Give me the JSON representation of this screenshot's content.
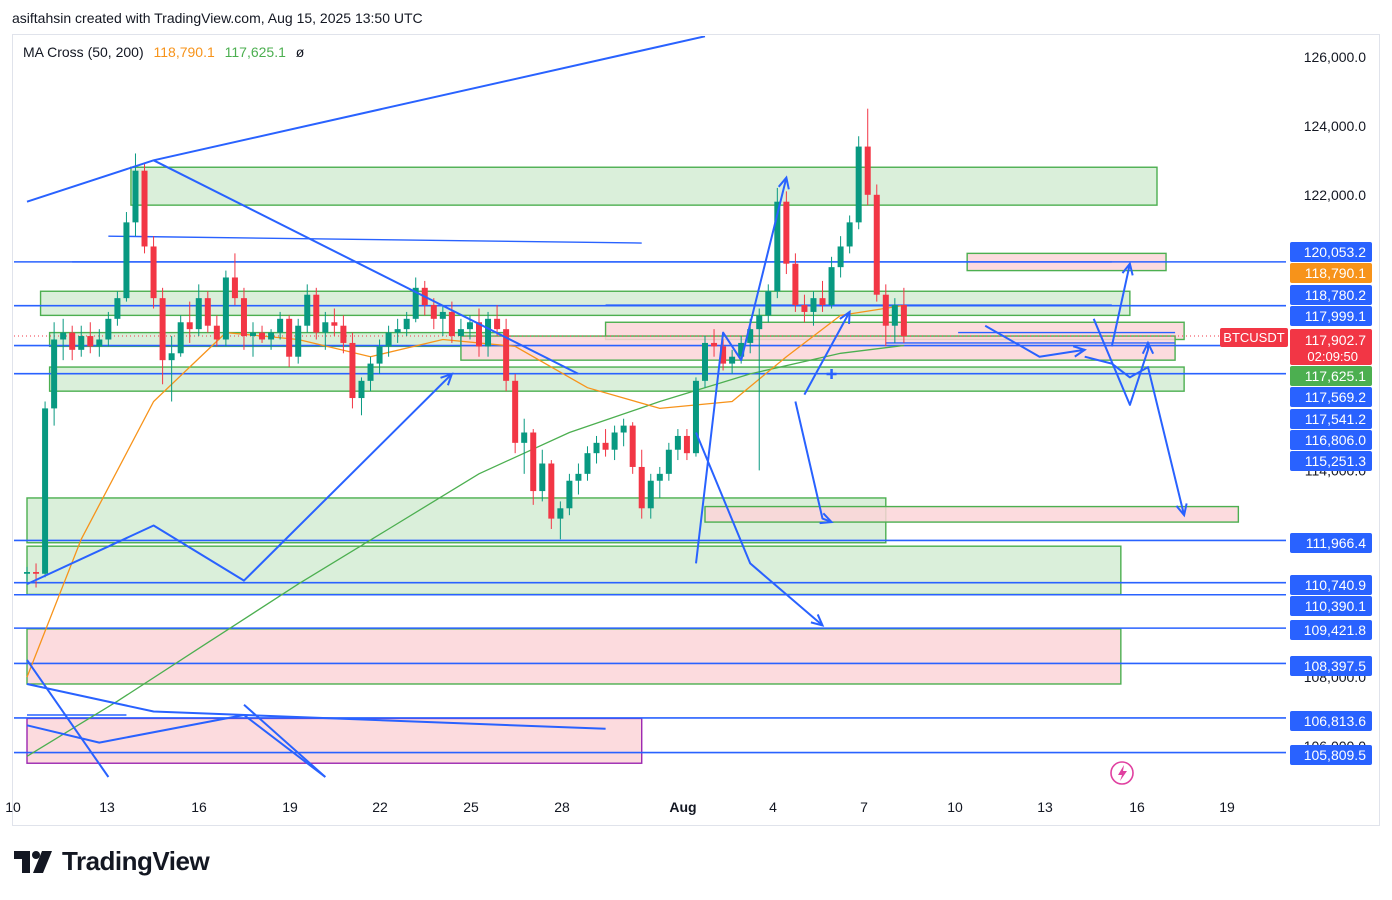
{
  "header": {
    "caption": "asiftahsin created with TradingView.com, Aug 15, 2025 13:50 UTC"
  },
  "legend": {
    "indicator": "MA Cross (50, 200)",
    "ma50_value": "118,790.1",
    "ma200_value": "117,625.1",
    "extra": "ø"
  },
  "symbol": {
    "ticker": "BTCUSDT",
    "price": "117,902.7",
    "countdown": "02:09:50"
  },
  "brand": {
    "name": "TradingView"
  },
  "colors": {
    "up": "#089981",
    "down": "#f23645",
    "ma50": "#f7931a",
    "ma200": "#4caf50",
    "drawing": "#2962ff",
    "zone_green_fill": "#d3ecd3",
    "zone_green_stroke": "#4caf50",
    "zone_pink_fill": "#fbd5d8",
    "zone_purple_stroke": "#9c27b0",
    "label_blue": "#2962ff",
    "label_orange": "#f7931a",
    "label_green": "#4caf50",
    "label_red": "#f23645"
  },
  "chart_data": {
    "type": "candlestick",
    "symbol": "BTCUSDT",
    "timeframe_note": "Jul 10 – Aug 15, 2025",
    "x_tick_labels": [
      "10",
      "13",
      "16",
      "19",
      "22",
      "25",
      "28",
      "Aug",
      "4",
      "7",
      "10",
      "13",
      "16",
      "19"
    ],
    "y_axis_ticks": [
      "126,000.0",
      "124,000.0",
      "122,000.0",
      "114,000.0",
      "108,000.0",
      "106,000.0"
    ],
    "ylim": [
      104800,
      127000
    ],
    "grid": false,
    "price_labels": [
      {
        "text": "120,053.2",
        "value": 120053.2,
        "style": "blue"
      },
      {
        "text": "118,790.1",
        "value": 118790.1,
        "style": "orange"
      },
      {
        "text": "118,780.2",
        "value": 118780.2,
        "style": "blue"
      },
      {
        "text": "117,999.1",
        "value": 117999.1,
        "style": "blue"
      },
      {
        "text": "117,625.1",
        "value": 117625.1,
        "style": "green"
      },
      {
        "text": "117,569.2",
        "value": 117569.2,
        "style": "blue"
      },
      {
        "text": "117,541.2",
        "value": 117541.2,
        "style": "blue"
      },
      {
        "text": "116,806.0",
        "value": 116806.0,
        "style": "blue"
      },
      {
        "text": "115,251.3",
        "value": 115251.3,
        "style": "blue"
      },
      {
        "text": "111,966.4",
        "value": 111966.4,
        "style": "blue"
      },
      {
        "text": "110,740.9",
        "value": 110740.9,
        "style": "blue"
      },
      {
        "text": "110,390.1",
        "value": 110390.1,
        "style": "blue"
      },
      {
        "text": "109,421.8",
        "value": 109421.8,
        "style": "blue"
      },
      {
        "text": "108,397.5",
        "value": 108397.5,
        "style": "blue"
      },
      {
        "text": "106,813.6",
        "value": 106813.6,
        "style": "blue"
      },
      {
        "text": "105,809.5",
        "value": 105809.5,
        "style": "blue"
      }
    ],
    "candles": [
      [
        111000,
        111200,
        110800,
        111050
      ],
      [
        111050,
        111300,
        110600,
        111000
      ],
      [
        111000,
        116000,
        110900,
        115800
      ],
      [
        115800,
        118300,
        115300,
        117800
      ],
      [
        117800,
        118400,
        117200,
        118000
      ],
      [
        118000,
        118200,
        117200,
        117500
      ],
      [
        117500,
        118200,
        117300,
        117900
      ],
      [
        117900,
        118300,
        117400,
        117600
      ],
      [
        117600,
        118100,
        117300,
        117800
      ],
      [
        117800,
        118600,
        117600,
        118400
      ],
      [
        118400,
        119200,
        118200,
        119000
      ],
      [
        119000,
        121500,
        118900,
        121200
      ],
      [
        121200,
        123200,
        120800,
        122700
      ],
      [
        122700,
        122900,
        120300,
        120500
      ],
      [
        120500,
        120800,
        118700,
        119000
      ],
      [
        119000,
        119300,
        116500,
        117200
      ],
      [
        117200,
        117900,
        116000,
        117400
      ],
      [
        117400,
        118500,
        117300,
        118300
      ],
      [
        118300,
        118900,
        117700,
        118100
      ],
      [
        118100,
        119400,
        117900,
        119000
      ],
      [
        119000,
        119200,
        118000,
        118200
      ],
      [
        118200,
        118500,
        117600,
        117800
      ],
      [
        117800,
        119800,
        117600,
        119600
      ],
      [
        119600,
        120300,
        118800,
        119000
      ],
      [
        119000,
        119300,
        117500,
        117900
      ],
      [
        117900,
        118300,
        117300,
        118000
      ],
      [
        118000,
        118200,
        117700,
        117800
      ],
      [
        117800,
        118100,
        117500,
        118000
      ],
      [
        118000,
        118600,
        117800,
        118400
      ],
      [
        118400,
        118500,
        117000,
        117300
      ],
      [
        117300,
        118400,
        117100,
        118200
      ],
      [
        118200,
        119400,
        118000,
        119100
      ],
      [
        119100,
        119300,
        117800,
        118000
      ],
      [
        118000,
        118600,
        117500,
        118300
      ],
      [
        118300,
        118700,
        117900,
        118200
      ],
      [
        118200,
        118500,
        117400,
        117700
      ],
      [
        117700,
        118000,
        115800,
        116100
      ],
      [
        116100,
        116700,
        115600,
        116600
      ],
      [
        116600,
        117300,
        116300,
        117100
      ],
      [
        117100,
        117800,
        116800,
        117600
      ],
      [
        117600,
        118200,
        117300,
        118000
      ],
      [
        118000,
        118400,
        117700,
        118100
      ],
      [
        118100,
        118600,
        117900,
        118400
      ],
      [
        118400,
        119600,
        118300,
        119300
      ],
      [
        119300,
        119500,
        118500,
        118800
      ],
      [
        118800,
        119000,
        118100,
        118400
      ],
      [
        118400,
        118800,
        117900,
        118600
      ],
      [
        118600,
        118900,
        117700,
        117900
      ],
      [
        117900,
        118400,
        117600,
        118100
      ],
      [
        118100,
        118500,
        117800,
        118300
      ],
      [
        118300,
        118700,
        117300,
        117600
      ],
      [
        117600,
        118600,
        117300,
        118400
      ],
      [
        118400,
        118800,
        117900,
        118100
      ],
      [
        118100,
        118400,
        116300,
        116600
      ],
      [
        116600,
        116800,
        114500,
        114800
      ],
      [
        114800,
        115500,
        113900,
        115100
      ],
      [
        115100,
        115200,
        113000,
        113400
      ],
      [
        113400,
        114600,
        113100,
        114200
      ],
      [
        114200,
        114300,
        112300,
        112600
      ],
      [
        112600,
        113100,
        112000,
        112900
      ],
      [
        112900,
        113900,
        112700,
        113700
      ],
      [
        113700,
        114200,
        113300,
        113900
      ],
      [
        113900,
        114700,
        113700,
        114500
      ],
      [
        114500,
        115000,
        114200,
        114800
      ],
      [
        114800,
        115200,
        114400,
        114600
      ],
      [
        114600,
        115300,
        114300,
        115100
      ],
      [
        115100,
        115500,
        114700,
        115300
      ],
      [
        115300,
        115400,
        113900,
        114100
      ],
      [
        114100,
        114600,
        112600,
        112900
      ],
      [
        112900,
        113900,
        112600,
        113700
      ],
      [
        113700,
        114100,
        113200,
        113900
      ],
      [
        113900,
        114800,
        113700,
        114600
      ],
      [
        114600,
        115200,
        114300,
        115000
      ],
      [
        115000,
        115200,
        114300,
        114500
      ],
      [
        114500,
        116700,
        114400,
        116600
      ],
      [
        116600,
        117900,
        116400,
        117700
      ],
      [
        117700,
        118100,
        117300,
        117600
      ],
      [
        117600,
        117800,
        116900,
        117100
      ],
      [
        117100,
        117500,
        116800,
        117300
      ],
      [
        117300,
        117900,
        117100,
        117700
      ],
      [
        117700,
        118400,
        117400,
        118100
      ],
      [
        118100,
        118700,
        114000,
        118500
      ],
      [
        118500,
        119400,
        118300,
        119200
      ],
      [
        119200,
        122200,
        119000,
        121800
      ],
      [
        121800,
        122100,
        119700,
        120000
      ],
      [
        120000,
        120300,
        118600,
        118800
      ],
      [
        118800,
        119100,
        118300,
        118600
      ],
      [
        118600,
        119200,
        118200,
        119000
      ],
      [
        119000,
        119500,
        118600,
        118800
      ],
      [
        118800,
        120200,
        118700,
        119900
      ],
      [
        119900,
        120800,
        119600,
        120500
      ],
      [
        120500,
        121400,
        120300,
        121200
      ],
      [
        121200,
        123700,
        121000,
        123400
      ],
      [
        123400,
        124500,
        121700,
        122000
      ],
      [
        122000,
        122300,
        118900,
        119100
      ],
      [
        119100,
        119400,
        117600,
        118200
      ],
      [
        118200,
        119000,
        117700,
        118800
      ],
      [
        118800,
        119300,
        117700,
        117900
      ]
    ],
    "ma50": [
      [
        0,
        108000
      ],
      [
        6,
        112000
      ],
      [
        14,
        116000
      ],
      [
        22,
        118000
      ],
      [
        30,
        117800
      ],
      [
        38,
        117300
      ],
      [
        46,
        117800
      ],
      [
        54,
        117600
      ],
      [
        62,
        116400
      ],
      [
        70,
        115800
      ],
      [
        78,
        116000
      ],
      [
        84,
        117300
      ],
      [
        90,
        118500
      ],
      [
        97,
        118790
      ]
    ],
    "ma200": [
      [
        0,
        105700
      ],
      [
        10,
        107300
      ],
      [
        20,
        109000
      ],
      [
        30,
        110700
      ],
      [
        40,
        112300
      ],
      [
        50,
        113900
      ],
      [
        60,
        115100
      ],
      [
        70,
        116000
      ],
      [
        80,
        116800
      ],
      [
        90,
        117400
      ],
      [
        97,
        117625
      ]
    ],
    "zones": [
      {
        "kind": "green",
        "i0": 11.5,
        "i1": 125,
        "y0": 121700,
        "y1": 122800
      },
      {
        "kind": "pink",
        "i0": 104,
        "i1": 126,
        "y0": 119800,
        "y1": 120300
      },
      {
        "kind": "green",
        "i0": 1.5,
        "i1": 122,
        "y0": 118500,
        "y1": 119200
      },
      {
        "kind": "green",
        "i0": 2.5,
        "i1": 53,
        "y0": 117600,
        "y1": 118000
      },
      {
        "kind": "pink",
        "i0": 64,
        "i1": 128,
        "y0": 117800,
        "y1": 118300
      },
      {
        "kind": "pink",
        "i0": 48,
        "i1": 127,
        "y0": 117200,
        "y1": 117900
      },
      {
        "kind": "green",
        "i0": 2.5,
        "i1": 128,
        "y0": 116300,
        "y1": 117000
      },
      {
        "kind": "green",
        "i0": 0,
        "i1": 95,
        "y0": 111900,
        "y1": 113200
      },
      {
        "kind": "pink",
        "i0": 75,
        "i1": 134,
        "y0": 112500,
        "y1": 112950
      },
      {
        "kind": "green",
        "i0": 0,
        "i1": 121,
        "y0": 110400,
        "y1": 111800
      },
      {
        "kind": "pink",
        "i0": 0,
        "i1": 121,
        "y0": 107800,
        "y1": 109400
      },
      {
        "kind": "pinkpurple",
        "i0": 0,
        "i1": 68,
        "y0": 105500,
        "y1": 106800
      }
    ],
    "hlines": [
      120053.2,
      118780.2,
      117625.1,
      116806.0,
      111966.4,
      110740.9,
      110390.1,
      109421.8,
      108397.5,
      106813.6,
      105809.5
    ],
    "short_segments": [
      {
        "i0": 9,
        "i1": 68,
        "y0": 120800,
        "y1": 120600
      },
      {
        "i0": 5,
        "i1": 120,
        "y0": 120050,
        "y1": 120050
      },
      {
        "i0": 0,
        "i1": 11,
        "y0": 106900,
        "y1": 106900
      },
      {
        "i0": 95,
        "i1": 127,
        "y0": 117700,
        "y1": 117700
      },
      {
        "i0": 64,
        "i1": 120,
        "y0": 118800,
        "y1": 118800
      },
      {
        "i0": 103,
        "i1": 127,
        "y0": 118000,
        "y1": 118000
      }
    ],
    "drawn_trend_lines": [
      {
        "points": [
          [
            0,
            121800
          ],
          [
            14,
            123000
          ],
          [
            75,
            126600
          ]
        ]
      },
      {
        "points": [
          [
            14,
            123000
          ],
          [
            61,
            116800
          ]
        ]
      },
      {
        "points": [
          [
            0,
            107800
          ],
          [
            14,
            107000
          ],
          [
            64,
            106500
          ]
        ]
      },
      {
        "points": [
          [
            0,
            108500
          ],
          [
            9,
            105100
          ]
        ]
      },
      {
        "points": [
          [
            24,
            107200
          ],
          [
            33,
            105100
          ]
        ]
      },
      {
        "points": [
          [
            0,
            110700
          ],
          [
            14,
            112400
          ],
          [
            24,
            110800
          ],
          [
            47,
            116800
          ]
        ],
        "arrow": true
      },
      {
        "points": [
          [
            0,
            106600
          ],
          [
            8,
            106100
          ],
          [
            24,
            106900
          ],
          [
            33,
            105100
          ]
        ]
      },
      {
        "points": [
          [
            74,
            111300
          ],
          [
            77,
            118000
          ],
          [
            79,
            117200
          ],
          [
            84,
            122500
          ]
        ],
        "arrow": true
      },
      {
        "points": [
          [
            74,
            115100
          ],
          [
            80,
            111300
          ],
          [
            88,
            109500
          ]
        ],
        "arrow": true
      },
      {
        "points": [
          [
            86,
            116200
          ],
          [
            91,
            118600
          ]
        ],
        "arrow": true
      },
      {
        "points": [
          [
            85,
            116000
          ],
          [
            88,
            112600
          ],
          [
            89,
            112500
          ]
        ],
        "arrow": true
      },
      {
        "points": [
          [
            106,
            118200
          ],
          [
            112,
            117300
          ],
          [
            117,
            117500
          ]
        ],
        "arrow": true
      },
      {
        "points": [
          [
            118,
            118400
          ],
          [
            122,
            115900
          ],
          [
            124,
            117500
          ],
          [
            124,
            117700
          ]
        ],
        "arrow": true
      },
      {
        "points": [
          [
            120,
            117600
          ],
          [
            122,
            120000
          ]
        ],
        "arrow": true
      },
      {
        "points": [
          [
            117,
            117300
          ],
          [
            120,
            117100
          ],
          [
            122,
            116700
          ],
          [
            124,
            117000
          ],
          [
            128,
            112700
          ]
        ],
        "arrow": true
      }
    ],
    "crosshair": {
      "i": 89,
      "y": 116800
    },
    "last_price_line": 117902.7
  }
}
